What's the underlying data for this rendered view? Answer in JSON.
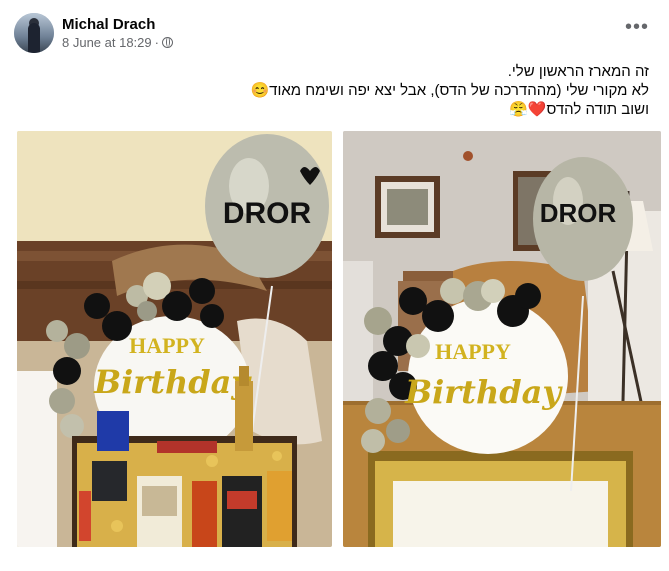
{
  "post": {
    "author": "Michal Drach",
    "timestamp": "8 June at 18:29",
    "separator": "·",
    "more_label": "•••",
    "lines": [
      "זה המארז הראשון שלי.",
      "לא מקורי שלי (מההדרכה של הדס), אבל יצא יפה ושימח מאוד😊",
      "ושוב תודה להדס❤️😤"
    ]
  },
  "photos": [
    {
      "balloon_text": "DROR",
      "sign_line1": "HAPPY",
      "sign_line2": "Birthday"
    },
    {
      "balloon_text": "DROR",
      "sign_line1": "HAPPY",
      "sign_line2": "Birthday"
    }
  ],
  "icons": {
    "audience": "globe-icon",
    "menu": "more-options-icon"
  }
}
